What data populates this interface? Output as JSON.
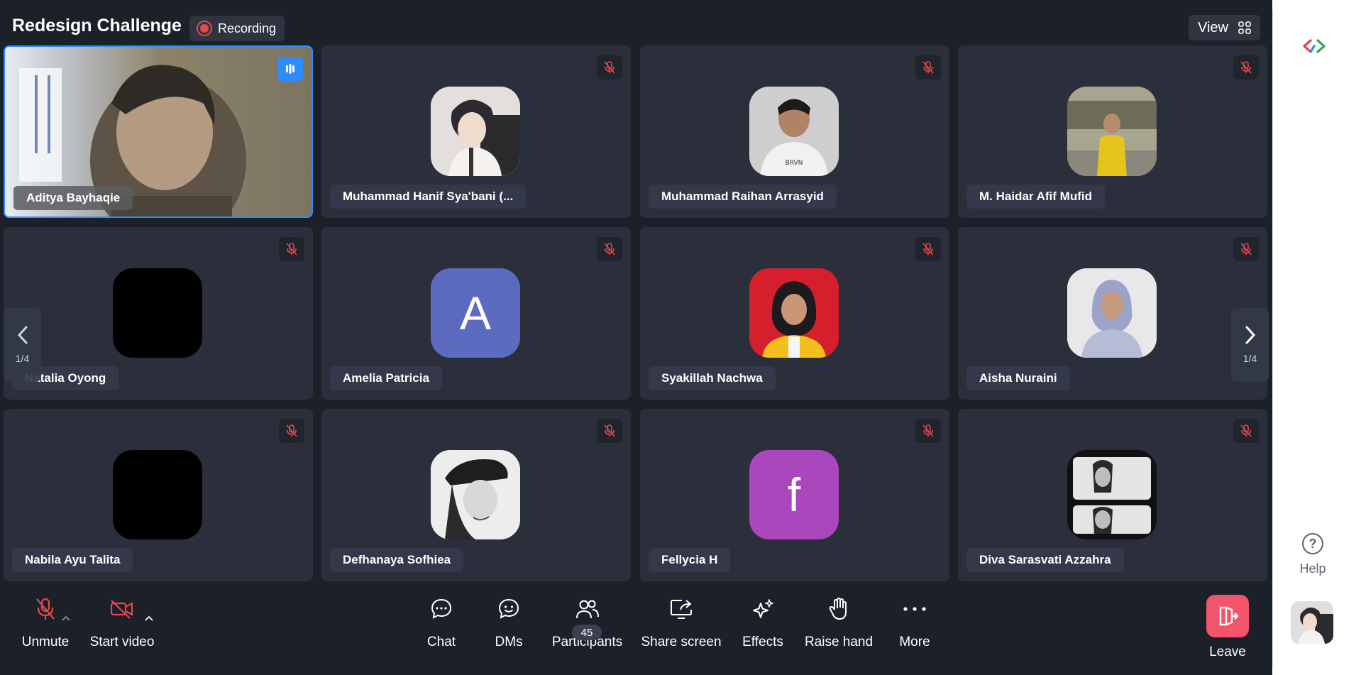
{
  "meeting": {
    "title": "Redesign Challenge",
    "recording_label": "Recording",
    "view_label": "View"
  },
  "participants": [
    {
      "name": "Aditya Bayhaqie",
      "state": "video-on, speaking"
    },
    {
      "name": "Muhammad Hanif Sya'bani (...",
      "state": "muted"
    },
    {
      "name": "Muhammad Raihan Arrasyid",
      "state": "muted"
    },
    {
      "name": "M. Haidar Afif Mufid",
      "state": "muted"
    },
    {
      "name": "Natalia Oyong",
      "state": "muted"
    },
    {
      "name": "Amelia Patricia",
      "state": "muted",
      "initial": "A"
    },
    {
      "name": "Syakillah Nachwa",
      "state": "muted"
    },
    {
      "name": "Aisha Nuraini",
      "state": "muted"
    },
    {
      "name": "Nabila Ayu Talita",
      "state": "muted"
    },
    {
      "name": "Defhanaya Sofhiea",
      "state": "muted"
    },
    {
      "name": "Fellycia H",
      "state": "muted",
      "initial": "f"
    },
    {
      "name": "Diva Sarasvati Azzahra",
      "state": "muted"
    }
  ],
  "pager": {
    "left_label": "1/4",
    "right_label": "1/4"
  },
  "toolbar": {
    "unmute": "Unmute",
    "start_video": "Start video",
    "chat": "Chat",
    "dms": "DMs",
    "participants": "Participants",
    "participants_count": "45",
    "share_screen": "Share screen",
    "effects": "Effects",
    "raise_hand": "Raise hand",
    "more": "More",
    "leave": "Leave"
  },
  "sidebar": {
    "help_label": "Help"
  },
  "colors": {
    "background": "#1b2029",
    "tile": "#2a2f3b",
    "accent_blue": "#2d8cff",
    "muted_red": "#e5484d",
    "leave_red": "#f2546b",
    "avatar_amelia": "#5c6bc0",
    "avatar_fellycia": "#ab47bc"
  },
  "icons": {
    "mic_off": "mic-off-icon",
    "video_off": "video-off-icon",
    "chat": "chat-bubble-icon",
    "dms": "smiley-bubble-icon",
    "participants": "people-icon",
    "share": "share-screen-icon",
    "effects": "sparkle-icon",
    "raise_hand": "hand-icon",
    "more": "ellipsis-icon",
    "leave": "door-exit-icon"
  }
}
